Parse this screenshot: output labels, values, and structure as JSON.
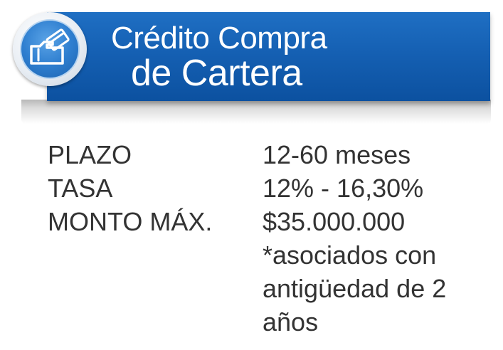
{
  "banner": {
    "title_line1": "Crédito Compra",
    "title_line2": "de Cartera",
    "icon": "hand-card-icon",
    "bg_color": "#1560b3"
  },
  "details": [
    {
      "label": "PLAZO",
      "value": "12-60 meses"
    },
    {
      "label": "TASA",
      "value": "12% - 16,30%"
    },
    {
      "label": "MONTO MÁX.",
      "value": "$35.000.000"
    }
  ],
  "note": "*asociados con antigüedad de 2 años",
  "colors": {
    "text": "#333333",
    "banner": "#1560b3"
  }
}
